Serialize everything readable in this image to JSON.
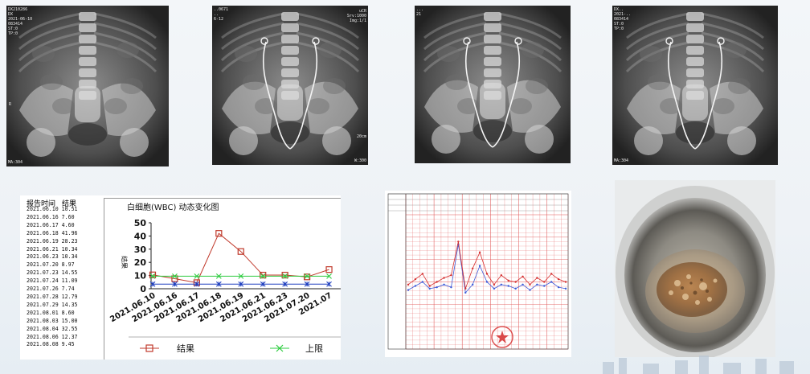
{
  "xray_panels": [
    {
      "name": "xray-1",
      "lines": [
        "DX210286",
        "DX",
        "2021-06-10",
        "083414",
        "ST:0",
        "TP:0"
      ],
      "side": "R",
      "bottom": "MA:304",
      "has_stent": false
    },
    {
      "name": "xray-2",
      "lines": [
        "..0671",
        "..",
        "6-12"
      ],
      "right_lines": [
        "uCR",
        "Srv:1000",
        "Img:1/1"
      ],
      "bottom": "W:300",
      "side_right": "20cm",
      "has_stent": true
    },
    {
      "name": "xray-3",
      "lines": [
        "...",
        "21"
      ],
      "has_stent": true
    },
    {
      "name": "xray-4",
      "lines": [
        "DX..",
        "2021-..",
        "083414",
        "ST:0",
        "TP:0"
      ],
      "bottom": "MA:304",
      "has_stent": true
    }
  ],
  "wbc_table": {
    "header_date": "报告时间",
    "header_result": "结果",
    "rows": [
      "2021.06.10 10.51",
      "2021.06.16 7.60",
      "2021.06.17 4.60",
      "2021.06.18 41.96",
      "2021.06.19 28.23",
      "2021.06.21 10.34",
      "2021.06.23 10.34",
      "2021.07.20 8.97",
      "2021.07.23 14.55",
      "2021.07.24 11.09",
      "2021.07.26 7.74",
      "2021.07.28 12.79",
      "2021.07.29 14.35",
      "2021.08.01 8.60",
      "2021.08.03 15.00",
      "2021.08.04 32.55",
      "2021.08.06 12.37",
      "2021.08.08 9.45"
    ]
  },
  "chart_data": {
    "type": "line",
    "title": "白细胞(WBC)  动态变化图",
    "ylabel": "结果",
    "ylim": [
      0,
      50
    ],
    "yticks": [
      0,
      10,
      20,
      30,
      40,
      50
    ],
    "categories": [
      "2021.06.10",
      "2021.06.16",
      "2021.06.17",
      "2021.06.18",
      "2021.06.19",
      "2021.06.21",
      "2021.06.23",
      "2021.07.20",
      "2021.07"
    ],
    "series": [
      {
        "name": "结果",
        "values": [
          10.51,
          7.6,
          4.6,
          41.96,
          28.23,
          10.34,
          10.34,
          8.97,
          14.55
        ],
        "color": "#c0392b"
      },
      {
        "name": "上限",
        "values": [
          9.5,
          9.5,
          9.5,
          9.5,
          9.5,
          9.5,
          9.5,
          9.5,
          9.5
        ],
        "color": "#2ecc40"
      },
      {
        "name": "",
        "values": [
          3.5,
          3.5,
          3.5,
          3.5,
          3.5,
          3.5,
          3.5,
          3.5,
          3.5
        ],
        "color": "#1f3fbf"
      }
    ],
    "legend": [
      {
        "label": "结果",
        "marker": "square"
      },
      {
        "label": "上限",
        "marker": "x"
      }
    ]
  },
  "temp_chart": {
    "points_red": [
      0.52,
      0.48,
      0.44,
      0.53,
      0.5,
      0.47,
      0.45,
      0.2,
      0.55,
      0.4,
      0.28,
      0.44,
      0.52,
      0.45,
      0.49,
      0.5,
      0.46,
      0.52,
      0.47,
      0.5,
      0.44,
      0.48,
      0.5
    ],
    "points_blue": [
      0.56,
      0.53,
      0.5,
      0.55,
      0.54,
      0.52,
      0.54,
      0.22,
      0.58,
      0.52,
      0.38,
      0.5,
      0.55,
      0.52,
      0.53,
      0.55,
      0.52,
      0.56,
      0.52,
      0.53,
      0.5,
      0.54,
      0.55
    ],
    "grid_color": "#e25b5b",
    "stamp_color": "#d42a2a"
  },
  "colors": {
    "bg": "#eef2f6",
    "red": "#c0392b",
    "green": "#2ecc40",
    "blue": "#1f3fbf"
  }
}
